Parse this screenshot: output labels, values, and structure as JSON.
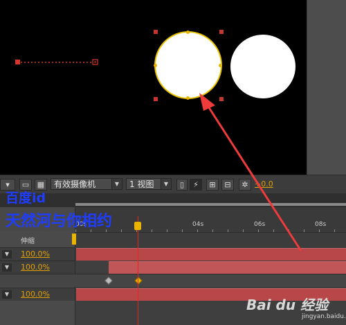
{
  "toolbar": {
    "camera_dropdown": "有效摄像机",
    "view_dropdown": "1 视图",
    "exposure_value": "+0.0"
  },
  "timeline": {
    "tab_label": "",
    "column_header": "伸缩",
    "ruler_ticks": [
      "00s",
      "04s",
      "06s",
      "08s"
    ],
    "layers": [
      {
        "stretch": "100.0%"
      },
      {
        "stretch": "100.0%"
      },
      {
        "stretch": "100.0%"
      }
    ]
  },
  "watermark": {
    "line1": "百度id",
    "line2": "天然河与你相约"
  },
  "logo": {
    "brand": "Bai du 经验",
    "url": "jingyan.baidu.com"
  },
  "colors": {
    "layer_bar": "#b8474a",
    "playhead": "#e8251a",
    "keyframe_selected": "#e8b400",
    "annotation_arrow": "#ef3b3b",
    "watermark_text": "#1f3dff"
  }
}
